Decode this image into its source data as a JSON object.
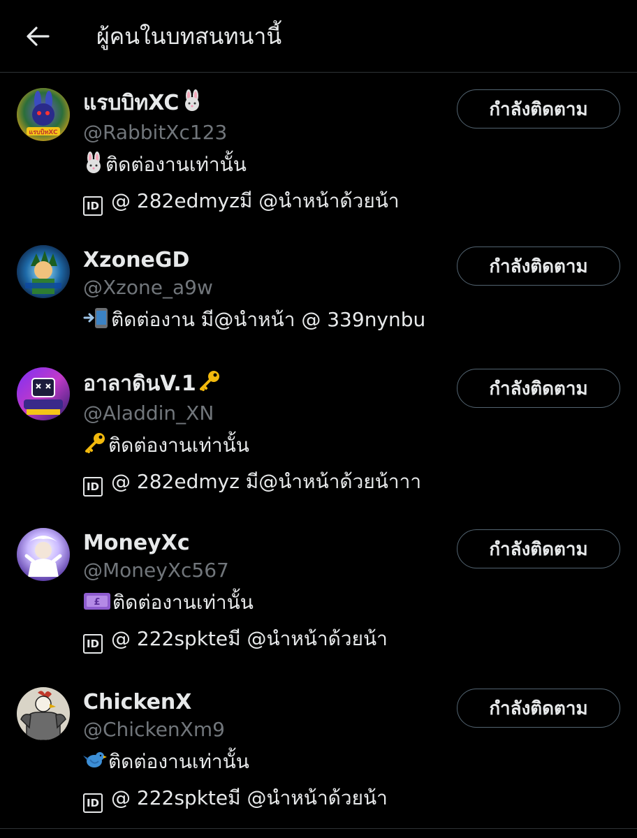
{
  "header": {
    "back_icon": "arrow-left-icon",
    "title": "ผู้คนในบทสนทนานี้"
  },
  "follow_label": "กำลังติดตาม",
  "users": [
    {
      "display_name": "แรบบิทXC",
      "name_emoji": "rabbit-face",
      "handle": "@RabbitXc123",
      "bio_line1_emoji": "rabbit-face",
      "bio_line1": "ติดต่องานเท่านั้น",
      "bio_line2_icon": "id-icon",
      "bio_line2": "@ 282edmyzมี @นำหน้าด้วยน้า",
      "avatar_label": "แรบบิทXC",
      "button": "กำลังติดตาม"
    },
    {
      "display_name": "XzoneGD",
      "handle": "@Xzone_a9w",
      "bio_line1_emoji": "mobile-arrow",
      "bio_line1": "ติดต่องาน มี@นำหน้า @ 339nynbu",
      "button": "กำลังติดตาม"
    },
    {
      "display_name": "อาลาดินV.1",
      "name_emoji": "key",
      "handle": "@Aladdin_XN",
      "bio_line1_emoji": "key",
      "bio_line1": "ติดต่องานเท่านั้น",
      "bio_line2_icon": "id-icon",
      "bio_line2": "@ 282edmyz มี@นำหน้าด้วยน้าาา",
      "button": "กำลังติดตาม"
    },
    {
      "display_name": "MoneyXc",
      "handle": "@MoneyXc567",
      "bio_line1_emoji": "pound-banknote",
      "bio_line1": "ติดต่องานเท่านั้น",
      "bio_line2_icon": "id-icon",
      "bio_line2": "@ 222spkteมี @นำหน้าด้วยน้า",
      "button": "กำลังติดตาม"
    },
    {
      "display_name": "ChickenX",
      "handle": "@ChickenXm9",
      "bio_line1_emoji": "blue-bird",
      "bio_line1": "ติดต่องานเท่านั้น",
      "bio_line2_icon": "id-icon",
      "bio_line2": "@ 222spkteมี @นำหน้าด้วยน้า",
      "button": "กำลังติดตาม"
    }
  ],
  "colors": {
    "background": "#000000",
    "text_primary": "#e7e9ea",
    "text_secondary": "#71767b",
    "button_border": "#536471",
    "divider": "#2f3336"
  }
}
